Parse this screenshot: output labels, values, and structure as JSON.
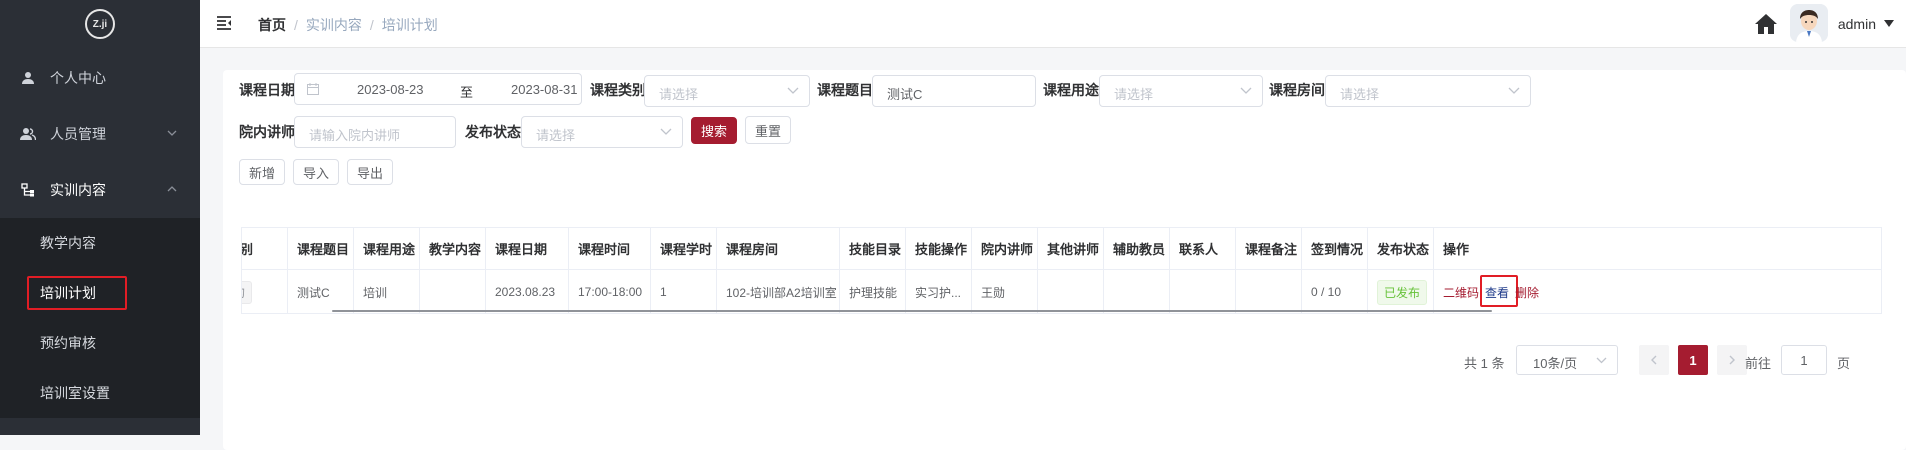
{
  "sidebar": {
    "logo_text": "Z.ji",
    "menu": [
      {
        "label": "个人中心",
        "icon": "user-icon"
      },
      {
        "label": "人员管理",
        "icon": "people-icon"
      },
      {
        "label": "实训内容",
        "icon": "tree-icon"
      }
    ],
    "submenu": [
      {
        "label": "教学内容"
      },
      {
        "label": "培训计划",
        "active": true
      },
      {
        "label": "预约审核"
      },
      {
        "label": "培训室设置"
      }
    ]
  },
  "header": {
    "breadcrumb": [
      "首页",
      "实训内容",
      "培训计划"
    ],
    "separator": "/",
    "user_name": "admin"
  },
  "filters": {
    "course_date": {
      "label": "课程日期",
      "start": "2023-08-23",
      "to": "至",
      "end": "2023-08-31"
    },
    "course_category": {
      "label": "课程类别",
      "placeholder": "请选择"
    },
    "course_title": {
      "label": "课程题目",
      "value": "测试C"
    },
    "course_purpose": {
      "label": "课程用途",
      "placeholder": "请选择"
    },
    "course_room": {
      "label": "课程房间",
      "placeholder": "请选择"
    },
    "lecturer": {
      "label": "院内讲师",
      "placeholder": "请输入院内讲师"
    },
    "publish_status": {
      "label": "发布状态",
      "placeholder": "请选择"
    },
    "search_label": "搜索",
    "reset_label": "重置"
  },
  "toolbar": {
    "add_label": "新增",
    "import_label": "导入",
    "export_label": "导出"
  },
  "table": {
    "columns": [
      "别",
      "课程题目",
      "课程用途",
      "教学内容",
      "课程日期",
      "课程时间",
      "课程学时",
      "课程房间",
      "技能目录",
      "技能操作",
      "院内讲师",
      "其他讲师",
      "辅助教员",
      "联系人",
      "课程备注",
      "签到情况",
      "发布状态",
      "操作"
    ],
    "rows": [
      {
        "category_tag": "的",
        "title": "测试C",
        "purpose": "培训",
        "content": "",
        "date": "2023.08.23",
        "time": "17:00-18:00",
        "hours": "1",
        "room": "102-培训部A2培训室",
        "skill_catalog": "护理技能",
        "skill_operation": "实习护...",
        "lecturer": "王勋",
        "other_lecturer": "",
        "assistant": "",
        "contact": "",
        "remark": "",
        "signin": "0 / 10",
        "status": "已发布",
        "actions": {
          "qrcode": "二维码",
          "view": "查看",
          "delete": "删除"
        }
      }
    ]
  },
  "pagination": {
    "total_text": "共 1 条",
    "page_size": "10条/页",
    "prev": "<",
    "current": "1",
    "next": ">",
    "goto_label": "前往",
    "goto_value": "1",
    "page_suffix": "页"
  },
  "colors": {
    "primary": "#a51c30",
    "sidebar": "#2b2f36",
    "highlight": "#e11d25",
    "success": "#67c23a"
  }
}
